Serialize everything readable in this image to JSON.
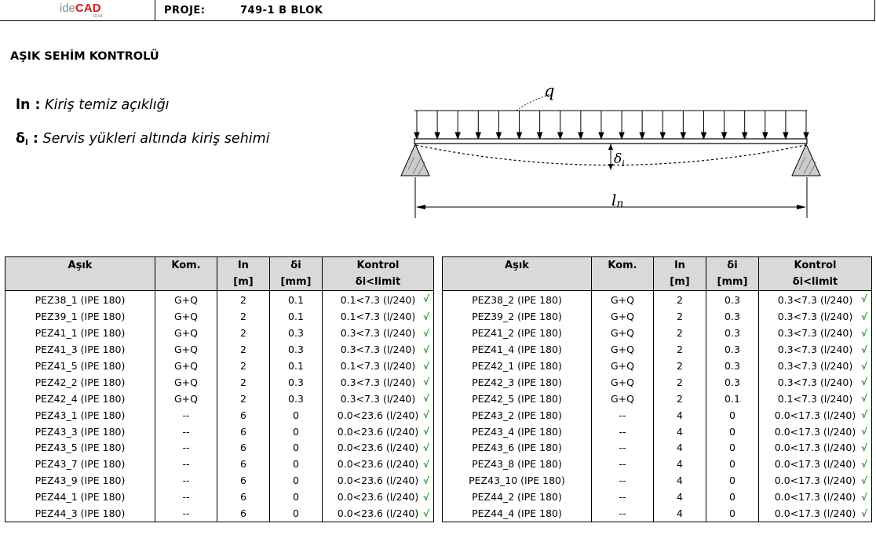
{
  "header": {
    "logo_ide": "ide",
    "logo_cad": "CAD",
    "logo_version": "10.64",
    "project_label": "PROJE:",
    "project_value": "749-1 B BLOK"
  },
  "title": "AŞIK SEHİM KONTROLÜ",
  "legend": {
    "ln_symbol": "ln :",
    "ln_text": "Kiriş temiz açıklığı",
    "d_symbol": "δ",
    "d_sub": "i",
    "d_colon": " :",
    "d_text": "Servis yükleri altında kiriş sehimi"
  },
  "diagram": {
    "q": "q",
    "delta": "δ",
    "delta_sub": "i",
    "span": "l",
    "span_sub": "n"
  },
  "columns": {
    "asik": "Aşık",
    "kom": "Kom.",
    "ln": "ln",
    "ln_unit": "[m]",
    "di": "δi",
    "di_unit": "[mm]",
    "kontrol": "Kontrol",
    "kontrol_sub": "δi<limit"
  },
  "check_mark": "√",
  "left_rows": [
    {
      "asik": "PEZ38_1 (IPE 180)",
      "kom": "G+Q",
      "ln": "2",
      "di": "0.1",
      "kontrol": "0.1<7.3 (l/240)"
    },
    {
      "asik": "PEZ39_1 (IPE 180)",
      "kom": "G+Q",
      "ln": "2",
      "di": "0.1",
      "kontrol": "0.1<7.3 (l/240)"
    },
    {
      "asik": "PEZ41_1 (IPE 180)",
      "kom": "G+Q",
      "ln": "2",
      "di": "0.3",
      "kontrol": "0.3<7.3 (l/240)"
    },
    {
      "asik": "PEZ41_3 (IPE 180)",
      "kom": "G+Q",
      "ln": "2",
      "di": "0.3",
      "kontrol": "0.3<7.3 (l/240)"
    },
    {
      "asik": "PEZ41_5 (IPE 180)",
      "kom": "G+Q",
      "ln": "2",
      "di": "0.1",
      "kontrol": "0.1<7.3 (l/240)"
    },
    {
      "asik": "PEZ42_2 (IPE 180)",
      "kom": "G+Q",
      "ln": "2",
      "di": "0.3",
      "kontrol": "0.3<7.3 (l/240)"
    },
    {
      "asik": "PEZ42_4 (IPE 180)",
      "kom": "G+Q",
      "ln": "2",
      "di": "0.3",
      "kontrol": "0.3<7.3 (l/240)"
    },
    {
      "asik": "PEZ43_1 (IPE 180)",
      "kom": "--",
      "ln": "6",
      "di": "0",
      "kontrol": "0.0<23.6 (l/240)"
    },
    {
      "asik": "PEZ43_3 (IPE 180)",
      "kom": "--",
      "ln": "6",
      "di": "0",
      "kontrol": "0.0<23.6 (l/240)"
    },
    {
      "asik": "PEZ43_5 (IPE 180)",
      "kom": "--",
      "ln": "6",
      "di": "0",
      "kontrol": "0.0<23.6 (l/240)"
    },
    {
      "asik": "PEZ43_7 (IPE 180)",
      "kom": "--",
      "ln": "6",
      "di": "0",
      "kontrol": "0.0<23.6 (l/240)"
    },
    {
      "asik": "PEZ43_9 (IPE 180)",
      "kom": "--",
      "ln": "6",
      "di": "0",
      "kontrol": "0.0<23.6 (l/240)"
    },
    {
      "asik": "PEZ44_1 (IPE 180)",
      "kom": "--",
      "ln": "6",
      "di": "0",
      "kontrol": "0.0<23.6 (l/240)"
    },
    {
      "asik": "PEZ44_3 (IPE 180)",
      "kom": "--",
      "ln": "6",
      "di": "0",
      "kontrol": "0.0<23.6 (l/240)"
    }
  ],
  "right_rows": [
    {
      "asik": "PEZ38_2 (IPE 180)",
      "kom": "G+Q",
      "ln": "2",
      "di": "0.3",
      "kontrol": "0.3<7.3 (l/240)"
    },
    {
      "asik": "PEZ39_2 (IPE 180)",
      "kom": "G+Q",
      "ln": "2",
      "di": "0.3",
      "kontrol": "0.3<7.3 (l/240)"
    },
    {
      "asik": "PEZ41_2 (IPE 180)",
      "kom": "G+Q",
      "ln": "2",
      "di": "0.3",
      "kontrol": "0.3<7.3 (l/240)"
    },
    {
      "asik": "PEZ41_4 (IPE 180)",
      "kom": "G+Q",
      "ln": "2",
      "di": "0.3",
      "kontrol": "0.3<7.3 (l/240)"
    },
    {
      "asik": "PEZ42_1 (IPE 180)",
      "kom": "G+Q",
      "ln": "2",
      "di": "0.3",
      "kontrol": "0.3<7.3 (l/240)"
    },
    {
      "asik": "PEZ42_3 (IPE 180)",
      "kom": "G+Q",
      "ln": "2",
      "di": "0.3",
      "kontrol": "0.3<7.3 (l/240)"
    },
    {
      "asik": "PEZ42_5 (IPE 180)",
      "kom": "G+Q",
      "ln": "2",
      "di": "0.1",
      "kontrol": "0.1<7.3 (l/240)"
    },
    {
      "asik": "PEZ43_2 (IPE 180)",
      "kom": "--",
      "ln": "4",
      "di": "0",
      "kontrol": "0.0<17.3 (l/240)"
    },
    {
      "asik": "PEZ43_4 (IPE 180)",
      "kom": "--",
      "ln": "4",
      "di": "0",
      "kontrol": "0.0<17.3 (l/240)"
    },
    {
      "asik": "PEZ43_6 (IPE 180)",
      "kom": "--",
      "ln": "4",
      "di": "0",
      "kontrol": "0.0<17.3 (l/240)"
    },
    {
      "asik": "PEZ43_8 (IPE 180)",
      "kom": "--",
      "ln": "4",
      "di": "0",
      "kontrol": "0.0<17.3 (l/240)"
    },
    {
      "asik": "PEZ43_10 (IPE 180)",
      "kom": "--",
      "ln": "4",
      "di": "0",
      "kontrol": "0.0<17.3 (l/240)"
    },
    {
      "asik": "PEZ44_2 (IPE 180)",
      "kom": "--",
      "ln": "4",
      "di": "0",
      "kontrol": "0.0<17.3 (l/240)"
    },
    {
      "asik": "PEZ44_4 (IPE 180)",
      "kom": "--",
      "ln": "4",
      "di": "0",
      "kontrol": "0.0<17.3 (l/240)"
    }
  ],
  "colors": {
    "logo_accent": "#d21a1a",
    "header_bg": "#d9d9d9",
    "check": "#1a9a1a"
  }
}
